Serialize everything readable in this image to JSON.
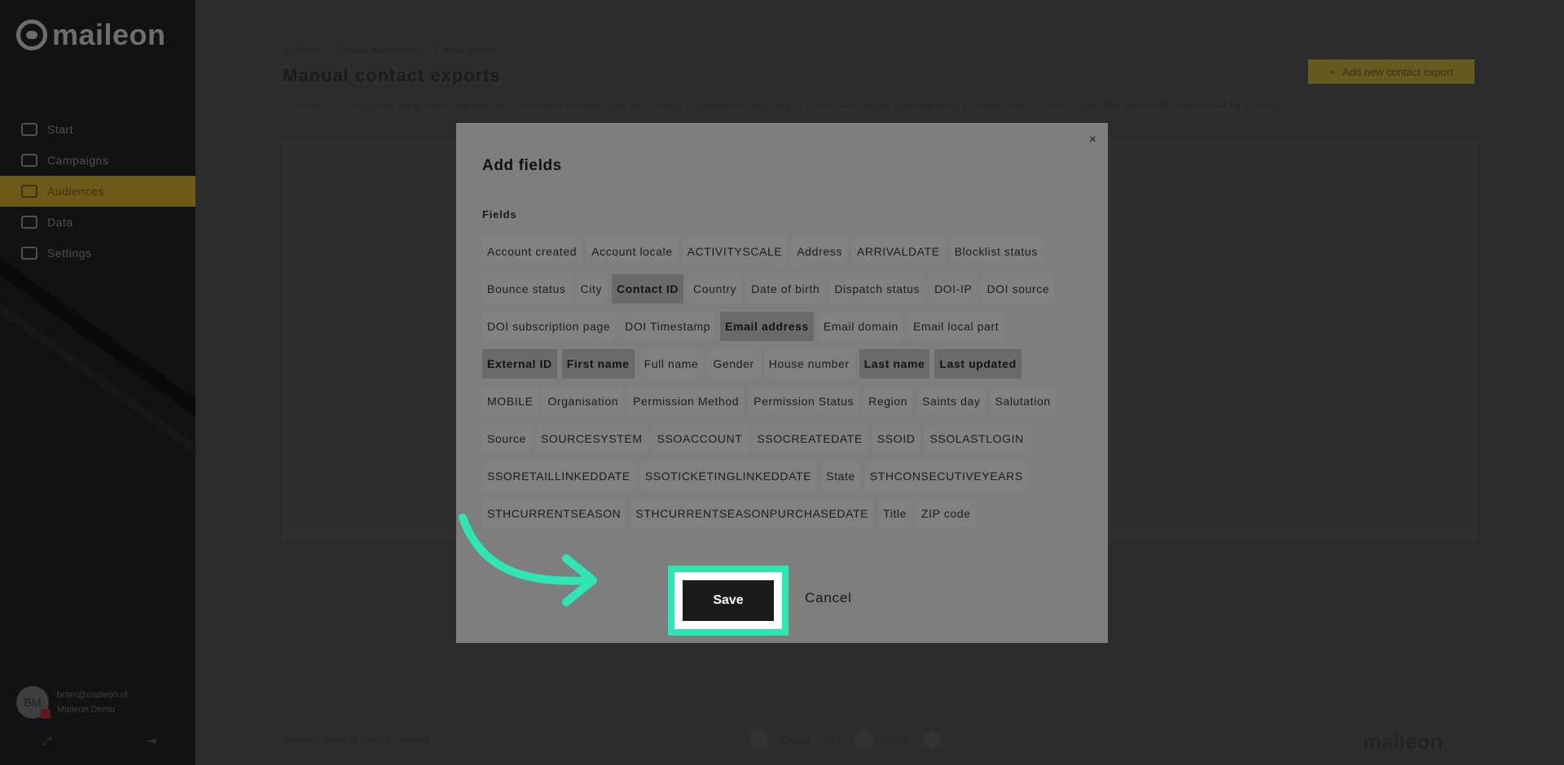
{
  "sidebar": {
    "logo_text": "maileon",
    "items": [
      {
        "label": "Start",
        "icon": "grid-icon"
      },
      {
        "label": "Campaigns",
        "icon": "megaphone-icon"
      },
      {
        "label": "Audiences",
        "icon": "people-icon",
        "active": true
      },
      {
        "label": "Data",
        "icon": "folder-icon"
      },
      {
        "label": "Settings",
        "icon": "gear-icon"
      }
    ],
    "user": {
      "initials": "BM",
      "email": "bram@maileon.nl",
      "account": "Maileon Demo"
    },
    "footer_icons": [
      "expand-icon",
      "logout-icon"
    ]
  },
  "main": {
    "breadcrumb": [
      "Audiences",
      "/",
      "Contact management",
      "/",
      "Contact exports"
    ],
    "title": "Manual contact exports",
    "description": "Contacts can be exported using contact exports. The structure of the export file, the contacts in general and the scope of contact data can be specified within a contact export. Contact export files are stored for download for 2 weeks.",
    "add_button": "Add new contact export",
    "footer_links": [
      "Contact",
      "Terms of Service",
      "Privacy"
    ],
    "footer_badges": [
      "Digital",
      "ISO",
      "CSA"
    ],
    "footer_logo": "maileon"
  },
  "modal": {
    "title": "Add fields",
    "fields_label": "Fields",
    "close": "×",
    "rows": [
      [
        {
          "label": "Account created"
        },
        {
          "label": "Account locale"
        },
        {
          "label": "ACTIVITYSCALE"
        },
        {
          "label": "Address"
        },
        {
          "label": "ARRIVALDATE"
        },
        {
          "label": "Blocklist status"
        }
      ],
      [
        {
          "label": "Bounce status"
        },
        {
          "label": "City"
        },
        {
          "label": "Contact ID",
          "selected": true
        },
        {
          "label": "Country"
        },
        {
          "label": "Date of birth"
        },
        {
          "label": "Dispatch status"
        },
        {
          "label": "DOI-IP"
        },
        {
          "label": "DOI source"
        }
      ],
      [
        {
          "label": "DOI subscription page"
        },
        {
          "label": "DOI Timestamp"
        },
        {
          "label": "Email address",
          "selected": true
        },
        {
          "label": "Email domain"
        },
        {
          "label": "Email local part"
        }
      ],
      [
        {
          "label": "External ID",
          "selected": true
        },
        {
          "label": "First name",
          "selected": true
        },
        {
          "label": "Full name"
        },
        {
          "label": "Gender"
        },
        {
          "label": "House number"
        },
        {
          "label": "Last name",
          "selected": true
        },
        {
          "label": "Last updated",
          "selected": true
        }
      ],
      [
        {
          "label": "MOBILE"
        },
        {
          "label": "Organisation"
        },
        {
          "label": "Permission Method"
        },
        {
          "label": "Permission Status"
        },
        {
          "label": "Region"
        },
        {
          "label": "Saints day"
        },
        {
          "label": "Salutation"
        }
      ],
      [
        {
          "label": "Source"
        },
        {
          "label": "SOURCESYSTEM"
        },
        {
          "label": "SSOACCOUNT"
        },
        {
          "label": "SSOCREATEDATE"
        },
        {
          "label": "SSOID"
        },
        {
          "label": "SSOLASTLOGIN"
        }
      ],
      [
        {
          "label": "SSORETAILLINKEDDATE"
        },
        {
          "label": "SSOTICKETINGLINKEDDATE"
        },
        {
          "label": "State"
        },
        {
          "label": "STHCONSECUTIVEYEARS"
        }
      ],
      [
        {
          "label": "STHCURRENTSEASON"
        },
        {
          "label": "STHCURRENTSEASONPURCHASEDATE"
        },
        {
          "label": "Title"
        },
        {
          "label": "ZIP code"
        }
      ]
    ],
    "save_label": "Save",
    "cancel_label": "Cancel"
  },
  "colors": {
    "highlight": "#2ee6b3",
    "accent": "#f2c600",
    "overlay": "rgba(0,0,0,0.5)"
  }
}
